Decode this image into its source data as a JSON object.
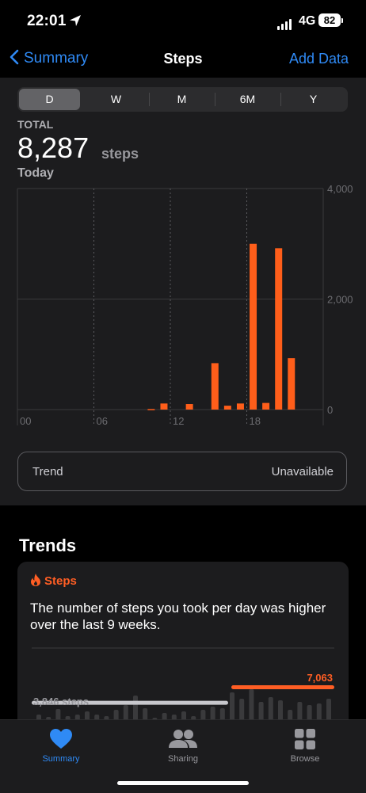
{
  "status_bar": {
    "time": "22:01",
    "network": "4G",
    "battery": "82"
  },
  "nav": {
    "back_label": "Summary",
    "title": "Steps",
    "action_label": "Add Data"
  },
  "segments": [
    {
      "label": "D",
      "active": true
    },
    {
      "label": "W",
      "active": false
    },
    {
      "label": "M",
      "active": false
    },
    {
      "label": "6M",
      "active": false
    },
    {
      "label": "Y",
      "active": false
    }
  ],
  "summary": {
    "total_label": "TOTAL",
    "total_value": "8,287",
    "unit": "steps",
    "period": "Today"
  },
  "chart_data": {
    "type": "bar",
    "x_ticks": [
      "00",
      "06",
      "12",
      "18"
    ],
    "y_ticks": [
      "4,000",
      "2,000",
      "0"
    ],
    "ylim": [
      0,
      4000
    ],
    "hours": [
      0,
      1,
      2,
      3,
      4,
      5,
      6,
      7,
      8,
      9,
      10,
      11,
      12,
      13,
      14,
      15,
      16,
      17,
      18,
      19,
      20,
      21,
      22,
      23
    ],
    "values": [
      0,
      0,
      0,
      0,
      0,
      0,
      0,
      0,
      0,
      0,
      10,
      110,
      0,
      100,
      0,
      840,
      70,
      110,
      3000,
      120,
      2920,
      930,
      0,
      0
    ],
    "color": "#ff5e1a"
  },
  "trend_row": {
    "label": "Trend",
    "value": "Unavailable"
  },
  "trends": {
    "heading": "Trends",
    "card_title": "Steps",
    "card_text": "The number of steps you took per day was higher over the last 9 weeks.",
    "mini_chart": {
      "left_avg_label": "3,846 steps",
      "right_avg_label": "7,063",
      "left_avg": 3846,
      "right_avg": 7063,
      "accent": "#ff5e24"
    }
  },
  "tabbar": [
    {
      "label": "Summary",
      "icon": "heart-icon",
      "active": true
    },
    {
      "label": "Sharing",
      "icon": "people-icon",
      "active": false
    },
    {
      "label": "Browse",
      "icon": "grid-icon",
      "active": false
    }
  ]
}
